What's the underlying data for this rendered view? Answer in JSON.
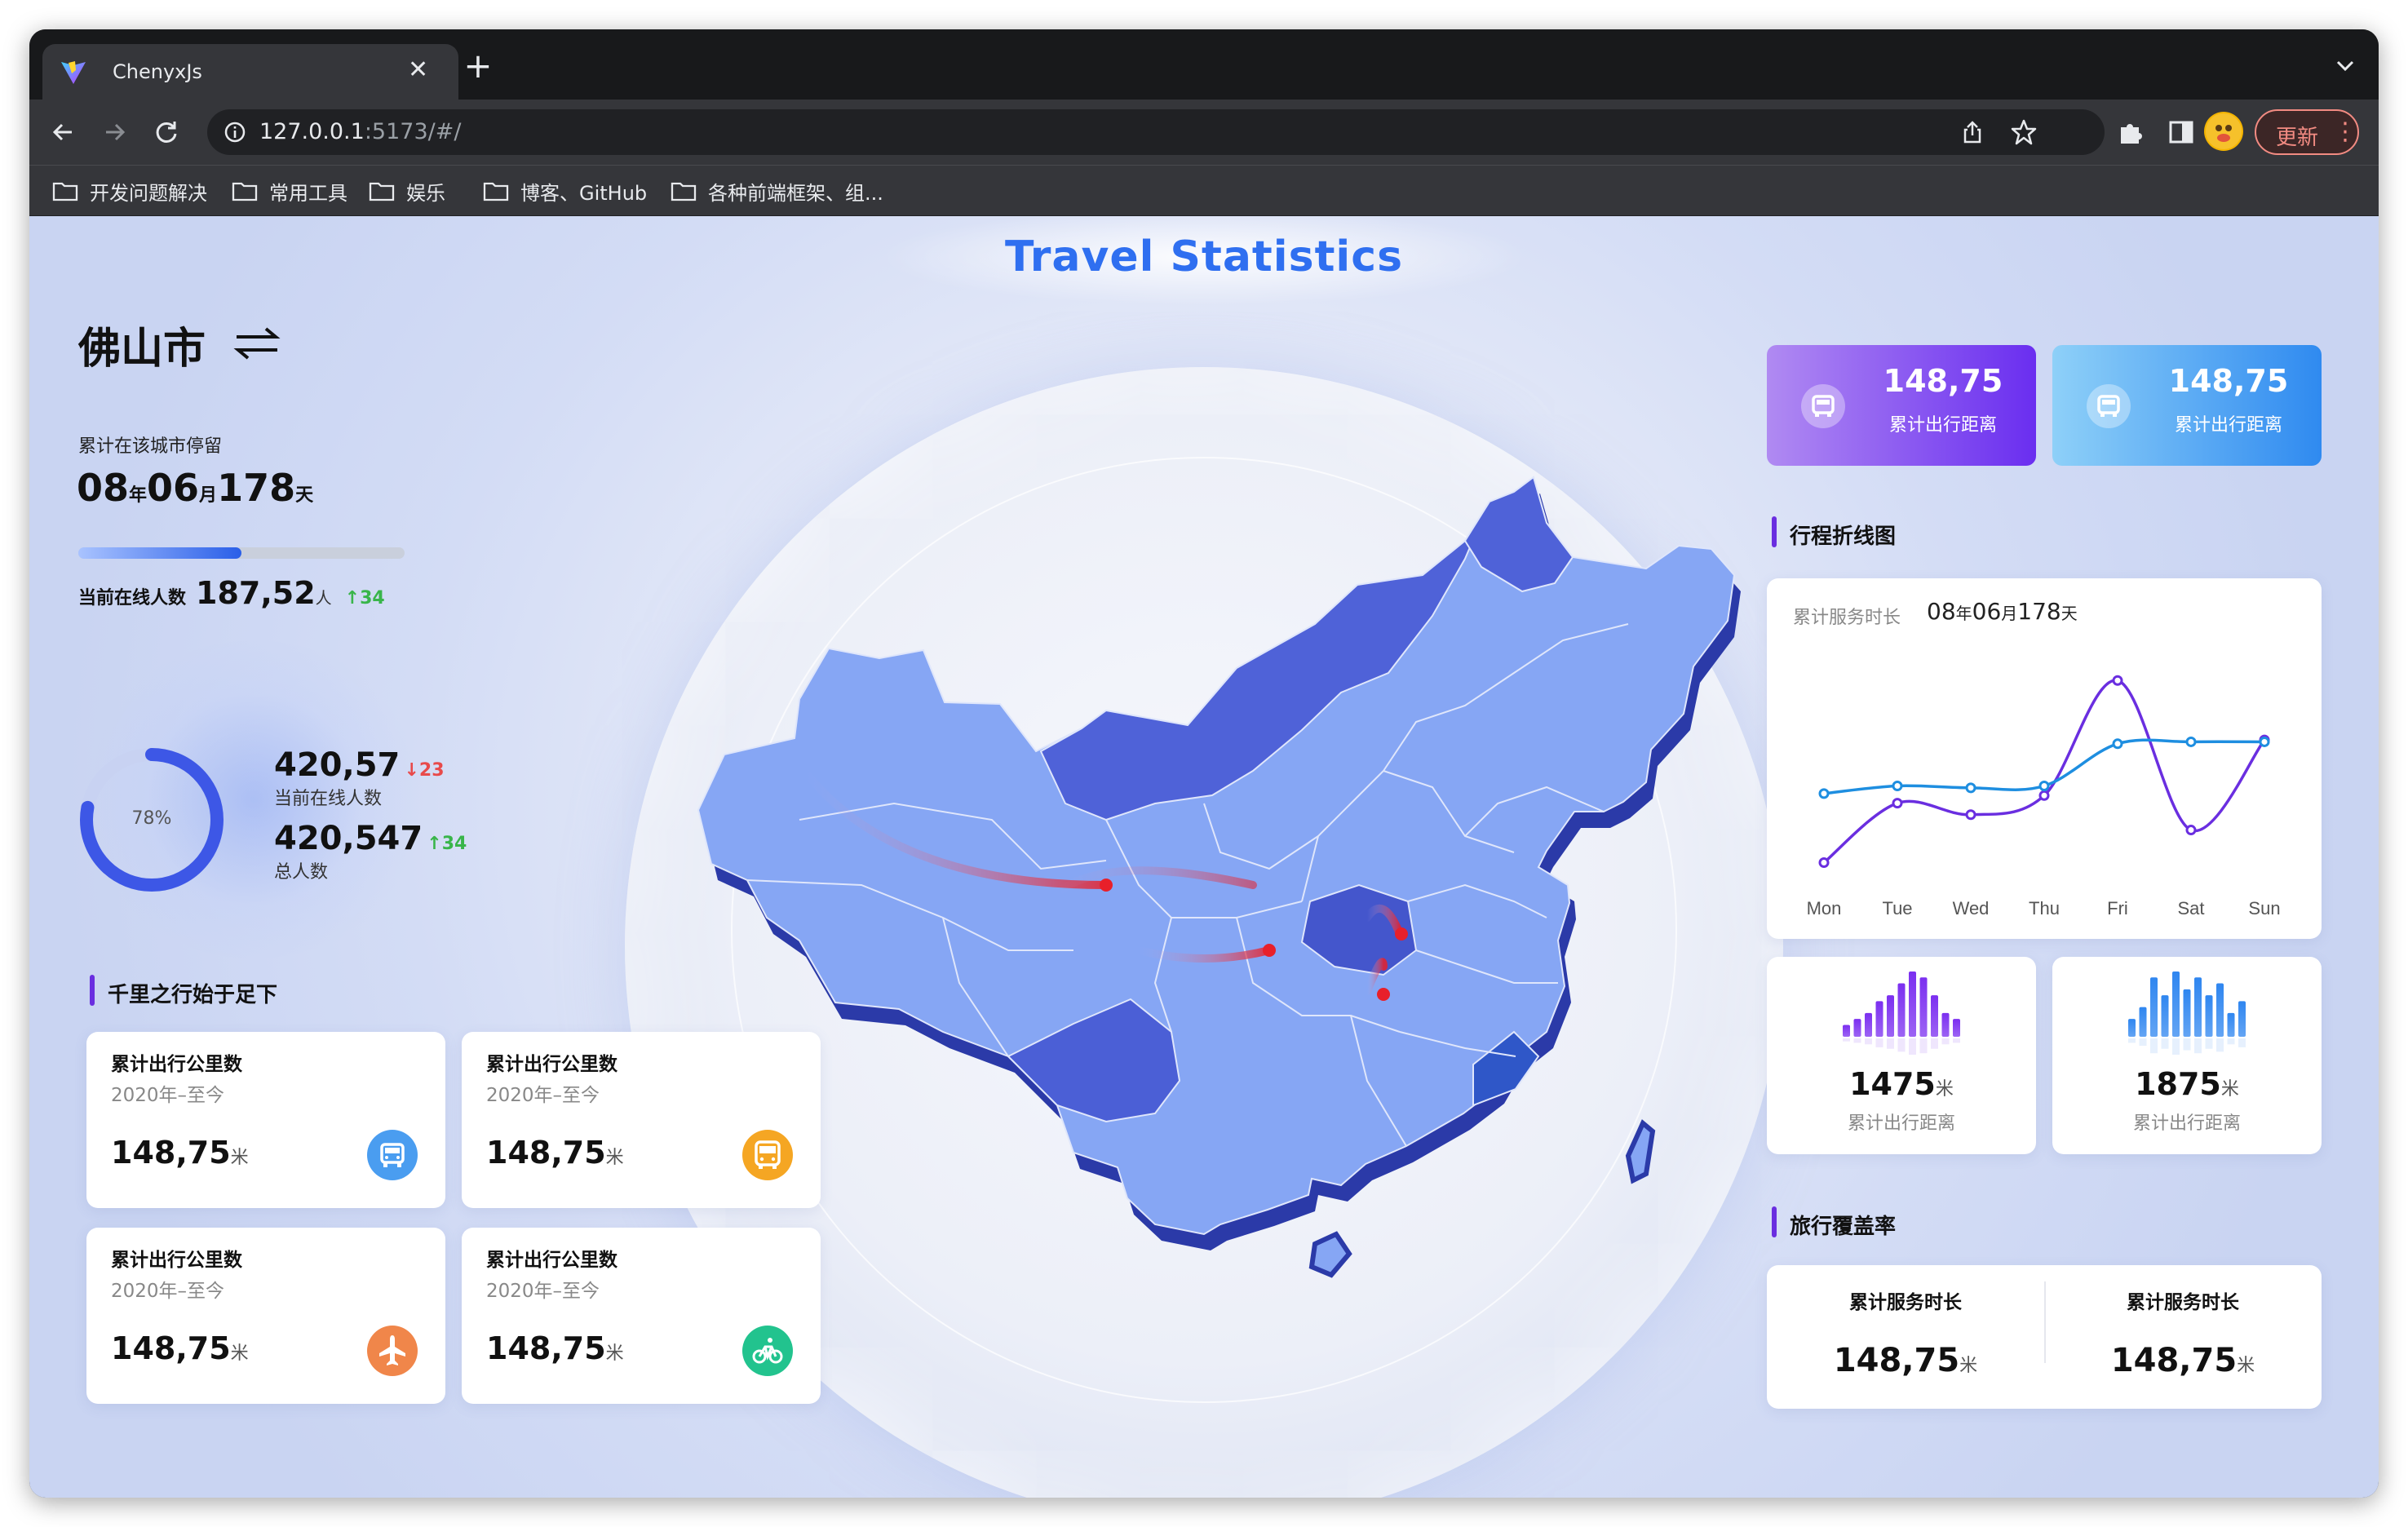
{
  "browser": {
    "tab_title": "ChenyxJs",
    "url_host": "127.0.0.1",
    "url_rest": ":5173/#/",
    "update_label": "更新",
    "bookmarks": [
      "开发问题解决",
      "常用工具",
      "娱乐",
      "博客、GitHub",
      "各种前端框架、组..."
    ]
  },
  "page": {
    "title": "Travel Statistics",
    "city": "佛山市",
    "stay_label": "累计在该城市停留",
    "stay": {
      "years": "08",
      "years_unit": "年",
      "months": "06",
      "months_unit": "月",
      "days": "178",
      "days_unit": "天"
    },
    "progress": 0.5,
    "online": {
      "label": "当前在线人数",
      "value": "187,52",
      "unit": "人",
      "delta": "↑34"
    },
    "ring": {
      "percent_label": "78%",
      "percent": 78
    },
    "stat1": {
      "value": "420,57",
      "delta": "↓23",
      "label": "当前在线人数"
    },
    "stat2": {
      "value": "420,547",
      "delta": "↑34",
      "label": "总人数"
    },
    "section_journey": "千里之行始于足下",
    "mileage_cards": [
      {
        "title": "累计出行公里数",
        "sub": "2020年–至今",
        "value": "148,75",
        "unit": "米",
        "icon": "car-icon",
        "color": "#4a9df0"
      },
      {
        "title": "累计出行公里数",
        "sub": "2020年–至今",
        "value": "148,75",
        "unit": "米",
        "icon": "bus-icon",
        "color": "#f5a623"
      },
      {
        "title": "累计出行公里数",
        "sub": "2020年–至今",
        "value": "148,75",
        "unit": "米",
        "icon": "plane-icon",
        "color": "#f0864a"
      },
      {
        "title": "累计出行公里数",
        "sub": "2020年–至今",
        "value": "148,75",
        "unit": "米",
        "icon": "bike-icon",
        "color": "#22c38e"
      }
    ],
    "top_cards": [
      {
        "value": "148,75",
        "label": "累计出行距离",
        "icon": "car-icon"
      },
      {
        "value": "148,75",
        "label": "累计出行距离",
        "icon": "car-icon"
      }
    ],
    "section_line": "行程折线图",
    "line_header": {
      "label": "累计服务时长",
      "value_y": "08",
      "unit_y": "年",
      "value_m": "06",
      "unit_m": "月",
      "value_d": "178",
      "unit_d": "天"
    },
    "bar_cards": [
      {
        "value": "1475",
        "unit": "米",
        "label": "累计出行距离",
        "color": "#7b2ff0"
      },
      {
        "value": "1875",
        "unit": "米",
        "label": "累计出行距离",
        "color": "#2f86f0"
      }
    ],
    "section_coverage": "旅行覆盖率",
    "coverage": [
      {
        "label": "累计服务时长",
        "value": "148,75",
        "unit": "米"
      },
      {
        "label": "累计服务时长",
        "value": "148,75",
        "unit": "米"
      }
    ]
  },
  "chart_data": [
    {
      "type": "line",
      "categories": [
        "Mon",
        "Tue",
        "Wed",
        "Thu",
        "Fri",
        "Sat",
        "Sun"
      ],
      "series": [
        {
          "values": [
            10,
            41,
            35,
            45,
            105,
            27,
            74
          ],
          "color": "#6a2ee0"
        },
        {
          "values": [
            46,
            50,
            49,
            50,
            72,
            73,
            73
          ],
          "color": "#1e8ee0"
        }
      ],
      "ylim": [
        0,
        120
      ],
      "grid": false
    },
    {
      "type": "bar",
      "values": [
        4,
        6,
        8,
        12,
        14,
        18,
        22,
        20,
        14,
        8,
        6
      ],
      "color": "#7b2ff0"
    },
    {
      "type": "bar",
      "values": [
        6,
        10,
        20,
        14,
        22,
        16,
        20,
        14,
        18,
        8,
        12
      ],
      "color": "#2f86f0"
    }
  ]
}
